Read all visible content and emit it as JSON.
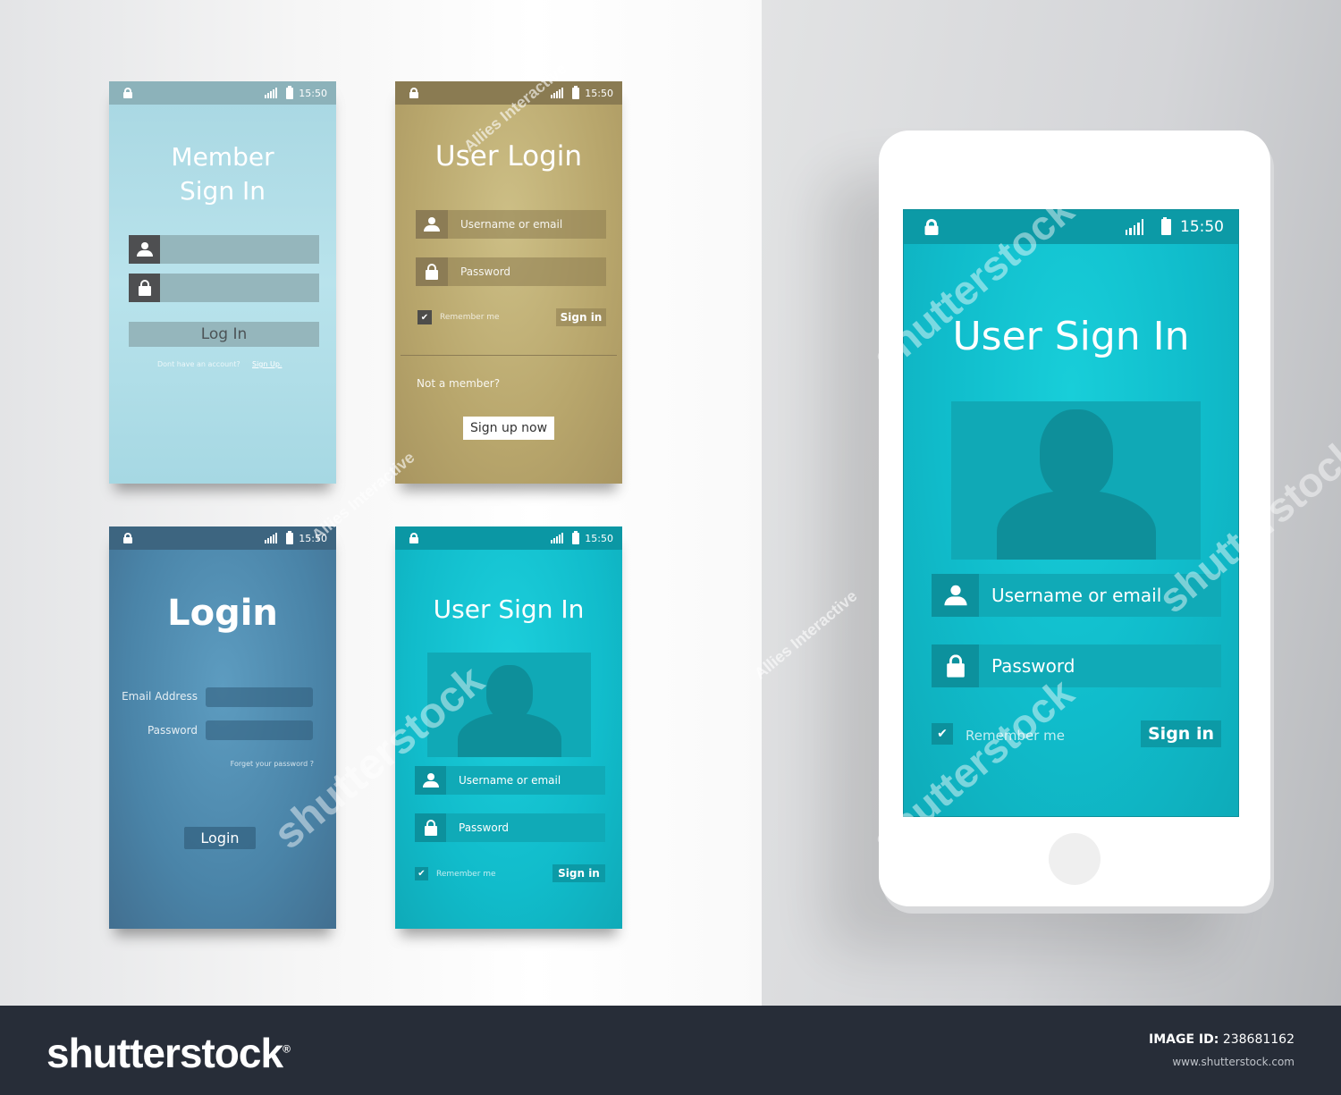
{
  "status_bar": {
    "time": "15:50"
  },
  "screens": {
    "member_sign_in": {
      "title_line1": "Member",
      "title_line2": "Sign In",
      "username_value": "",
      "password_value": "",
      "login_button": "Log In",
      "no_account_text": "Dont have an account?",
      "sign_up_link": "Sign Up."
    },
    "user_login": {
      "title": "User Login",
      "username_placeholder": "Username or email",
      "password_placeholder": "Password",
      "remember_me": "Remember me",
      "remember_checked": true,
      "sign_in_button": "Sign in",
      "not_member_text": "Not a member?",
      "sign_up_button": "Sign up now"
    },
    "login": {
      "title": "Login",
      "email_label": "Email Address",
      "password_label": "Password",
      "forgot_link": "Forget your password ?",
      "login_button": "Login"
    },
    "user_sign_in_small": {
      "title": "User Sign In",
      "username_placeholder": "Username or email",
      "password_placeholder": "Password",
      "remember_me": "Remember me",
      "remember_checked": true,
      "sign_in_button": "Sign in"
    }
  },
  "phone": {
    "title": "User Sign In",
    "username_placeholder": "Username or email",
    "password_placeholder": "Password",
    "remember_me": "Remember me",
    "remember_checked": true,
    "sign_in_button": "Sign in"
  },
  "icons": {
    "lock": "lock-icon",
    "signal": "signal-icon",
    "battery": "battery-icon",
    "user": "user-icon",
    "check": "✔"
  },
  "footer": {
    "logo": "shutterstock",
    "registered": "®",
    "image_id_label": "IMAGE ID:",
    "image_id": "238681162",
    "url": "www.shutterstock.com"
  },
  "watermarks": {
    "brand": "shutterstock",
    "author": "Allies Interactive"
  },
  "colors": {
    "member_bg": "#b2dfe8",
    "login_gold_bg": "#bfae74",
    "login_blue_bg": "#5290b4",
    "teal_bg": "#13c2cf",
    "footer_bg": "#272d38"
  }
}
